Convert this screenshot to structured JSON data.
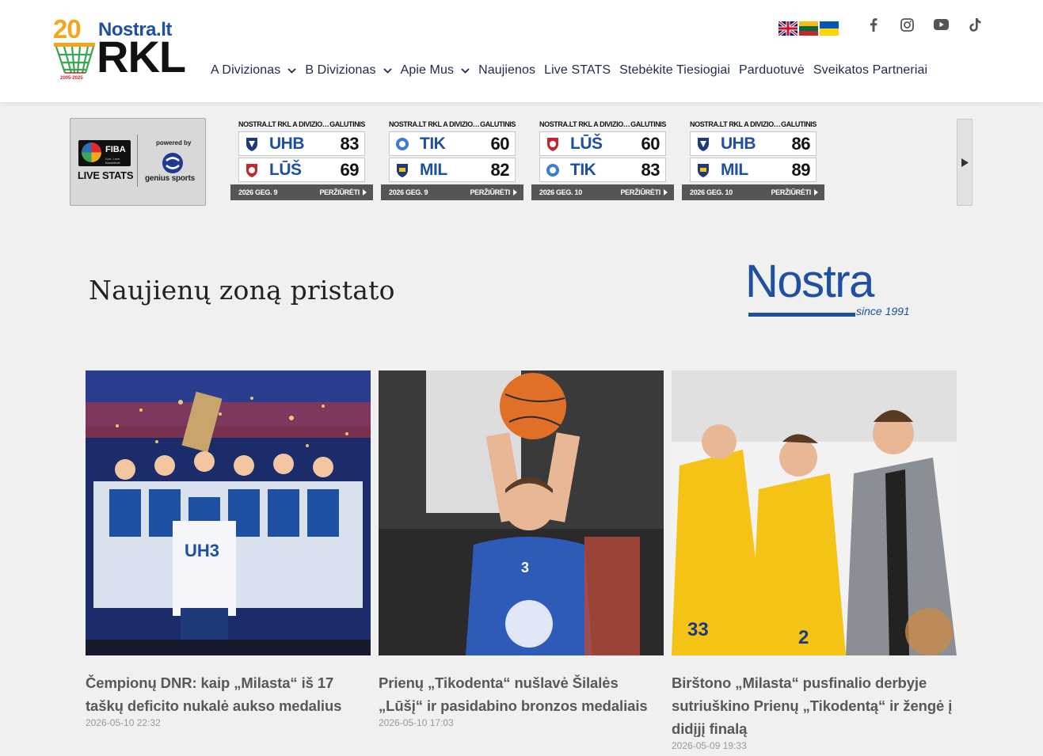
{
  "header": {
    "logo": {
      "number": "20",
      "brand_top": "Nostra.lt",
      "brand_main": "RKL",
      "years": "2005-2025"
    },
    "languages": [
      {
        "name": "english-flag"
      },
      {
        "name": "lithuanian-flag"
      },
      {
        "name": "ukrainian-flag"
      }
    ],
    "socials": [
      "facebook-icon",
      "instagram-icon",
      "youtube-icon",
      "tiktok-icon"
    ],
    "nav": [
      {
        "label": "A Divizionas",
        "dropdown": true
      },
      {
        "label": "B Divizionas",
        "dropdown": true
      },
      {
        "label": "Apie Mus",
        "dropdown": true
      },
      {
        "label": "Naujienos",
        "dropdown": false
      },
      {
        "label": "Live STATS",
        "dropdown": false
      },
      {
        "label": "Stebėkite Tiesiogiai",
        "dropdown": false
      },
      {
        "label": "Parduotuvė",
        "dropdown": false
      },
      {
        "label": "Sveikatos Partneriai",
        "dropdown": false
      }
    ]
  },
  "livestats": {
    "fiba": "FIBA",
    "fiba_sub": "Live. Love. Basketball",
    "label": "LIVE STATS",
    "powered_by": "powered by",
    "provider": "genius sports"
  },
  "games": [
    {
      "competition": "NOSTRA.LT RKL A DIVIZIONAS",
      "status": "GALUTINIS",
      "home": {
        "abbr": "UHB",
        "score": "83"
      },
      "away": {
        "abbr": "LŪŠ",
        "score": "69"
      },
      "date": "2026 GEG. 9",
      "view": "PERŽIŪRĖTI"
    },
    {
      "competition": "NOSTRA.LT RKL A DIVIZIONAS",
      "status": "GALUTINIS",
      "home": {
        "abbr": "TIK",
        "score": "60"
      },
      "away": {
        "abbr": "MIL",
        "score": "82"
      },
      "date": "2026 GEG. 9",
      "view": "PERŽIŪRĖTI"
    },
    {
      "competition": "NOSTRA.LT RKL A DIVIZIONAS",
      "status": "GALUTINIS",
      "home": {
        "abbr": "LŪŠ",
        "score": "60"
      },
      "away": {
        "abbr": "TIK",
        "score": "83"
      },
      "date": "2026 GEG. 10",
      "view": "PERŽIŪRĖTI"
    },
    {
      "competition": "NOSTRA.LT RKL A DIVIZIONAS",
      "status": "GALUTINIS",
      "home": {
        "abbr": "UHB",
        "score": "86"
      },
      "away": {
        "abbr": "MIL",
        "score": "89"
      },
      "date": "2026 GEG. 10",
      "view": "PERŽIŪRĖTI"
    }
  ],
  "sponsor": {
    "presents": "Naujienų zoną pristato",
    "name": "Nostra",
    "since": "since 1991"
  },
  "news": [
    {
      "title": "Čempionų DNR: kaip „Milasta“ iš 17 taškų deficito nukalė aukso medalius",
      "date": "2026-05-10 22:32"
    },
    {
      "title": "Prienų „Tikodenta“ nušlavė Šilalės „Lūšį“ ir pasidabino bronzos medaliais",
      "date": "2026-05-10 17:03"
    },
    {
      "title": "Birštono „Milasta“ pusfinalio derbyje sutriuškino Prienų „Tikodentą“ ir žengė į didįjį finalą",
      "date": "2026-05-09 19:33"
    }
  ]
}
